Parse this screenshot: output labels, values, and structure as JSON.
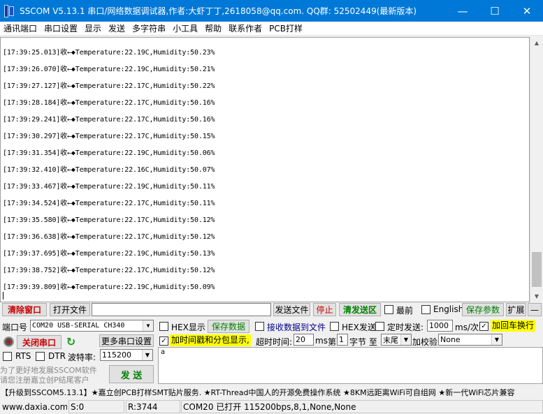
{
  "window": {
    "title": "SSCOM V5.13.1 串口/网络数据调试器,作者:大虾丁丁,2618058@qq.com. QQ群: 52502449(最新版本)",
    "minimize": "—",
    "maximize": "☐",
    "close": "✕"
  },
  "menu": [
    "通讯端口",
    "串口设置",
    "显示",
    "发送",
    "多字符串",
    "小工具",
    "帮助",
    "联系作者",
    "PCB打样"
  ],
  "receive": {
    "lines": [
      "[17:39:25.013]收←◆Temperature:22.19C,Humidity:50.23%",
      "[17:39:26.070]收←◆Temperature:22.19C,Humidity:50.21%",
      "[17:39:27.127]收←◆Temperature:22.17C,Humidity:50.22%",
      "[17:39:28.184]收←◆Temperature:22.17C,Humidity:50.16%",
      "[17:39:29.241]收←◆Temperature:22.17C,Humidity:50.16%",
      "[17:39:30.297]收←◆Temperature:22.17C,Humidity:50.15%",
      "[17:39:31.354]收←◆Temperature:22.19C,Humidity:50.06%",
      "[17:39:32.410]收←◆Temperature:22.16C,Humidity:50.07%",
      "[17:39:33.467]收←◆Temperature:22.19C,Humidity:50.11%",
      "[17:39:34.524]收←◆Temperature:22.17C,Humidity:50.11%",
      "[17:39:35.580]收←◆Temperature:22.17C,Humidity:50.12%",
      "[17:39:36.638]收←◆Temperature:22.17C,Humidity:50.12%",
      "[17:39:37.695]收←◆Temperature:22.19C,Humidity:50.13%",
      "[17:39:38.752]收←◆Temperature:22.17C,Humidity:50.12%",
      "[17:39:39.809]收←◆Temperature:22.19C,Humidity:50.09%"
    ]
  },
  "row1": {
    "clear_window": "清除窗口",
    "open_file": "打开文件",
    "file_path": "",
    "send_file": "发送文件",
    "stop": "停止",
    "clear_send": "清发送区",
    "topmost": "最前",
    "english": "English",
    "save_params": "保存参数",
    "expand": "扩展",
    "collapse": "—"
  },
  "row2": {
    "port_label": "端口号",
    "port_value": "COM20 USB-SERIAL CH340",
    "hex_display": "HEX显示",
    "save_data": "保存数据",
    "recv_to_file": "接收数据到文件",
    "hex_send": "HEX发送",
    "timed_send": "定时发送:",
    "interval_value": "1000",
    "interval_unit": "ms/次",
    "add_crlf": "加回车换行"
  },
  "row3": {
    "close_port": "关闭串口",
    "more_settings": "更多串口设置",
    "timestamp": "加时间戳和分包显示,",
    "timeout_label": "超时时间:",
    "timeout_value": "20",
    "timeout_unit": "ms",
    "nth_label": "第",
    "nth_value": "1",
    "byte_label": "字节 至",
    "end_value": "末尾",
    "checksum_label": "加校验",
    "checksum_value": "None"
  },
  "row4": {
    "rts": "RTS",
    "dtr": "DTR",
    "baud_label": "波特率:",
    "baud_value": "115200"
  },
  "promo": {
    "line1": "为了更好地发展SSCOM软件",
    "line2": "请您注册嘉立创P结尾客户",
    "send_button": "发 送"
  },
  "send_text": "a",
  "ticker": "【升级到SSCOM5.13.1】★嘉立创PCB打样SMT贴片服务. ★RT-Thread中国人的开源免费操作系统 ★8KM远距离WiFi可自组网 ★新一代WiFi芯片兼容",
  "status": {
    "site": "www.daxia.com",
    "sent": "S:0",
    "recv": "R:3744",
    "port_info": "COM20 已打开  115200bps,8,1,None,None"
  },
  "colors": {
    "titlebar": "#0078d7",
    "red_text": "#cc0000",
    "green_text": "#008000",
    "yellow_highlight": "#ffff00"
  }
}
